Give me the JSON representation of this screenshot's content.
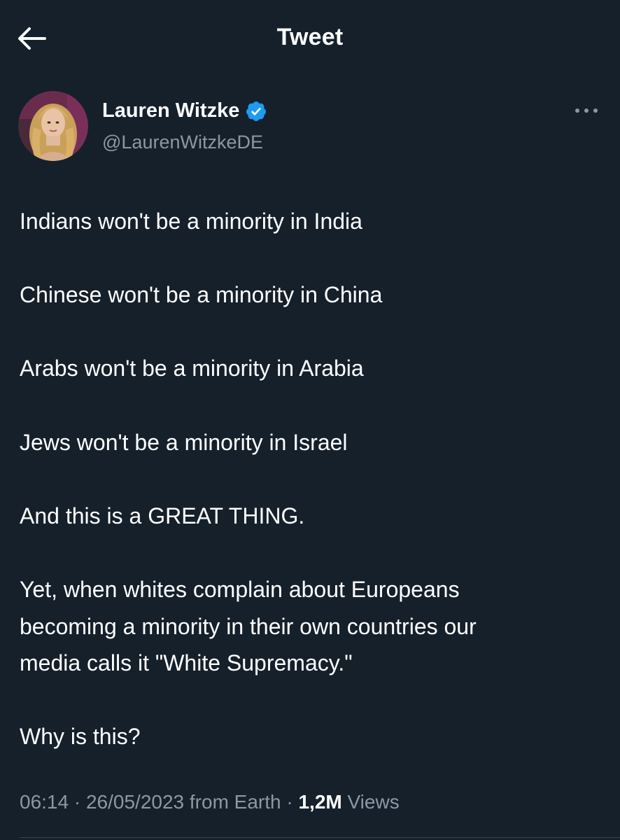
{
  "header": {
    "title": "Tweet",
    "back_icon": "arrow-left-icon"
  },
  "author": {
    "name": "Lauren Witzke",
    "handle": "@LaurenWitzkeDE",
    "verified": true,
    "verified_icon": "verified-badge-icon",
    "more_icon": "more-horizontal-icon"
  },
  "tweet": {
    "lines": [
      "Indians won't be a minority in India",
      "",
      "Chinese won't be a minority in China",
      "",
      "Arabs won't be a minority in Arabia",
      "",
      "Jews won't be a minority in Israel",
      "",
      "And this is a GREAT THING.",
      "",
      "Yet, when whites complain about Europeans",
      "becoming a minority in their own countries our",
      "media calls it \"White Supremacy.\"",
      "",
      "Why is this?"
    ]
  },
  "meta": {
    "time": "06:14",
    "separator": "·",
    "date": "26/05/2023",
    "source": "from Earth",
    "views_count": "1,2M",
    "views_label": "Views"
  },
  "colors": {
    "background": "#15202b",
    "text": "#ffffff",
    "secondary_text": "#8b98a5",
    "verified_blue": "#1d9bf0",
    "divider": "#38444d"
  }
}
